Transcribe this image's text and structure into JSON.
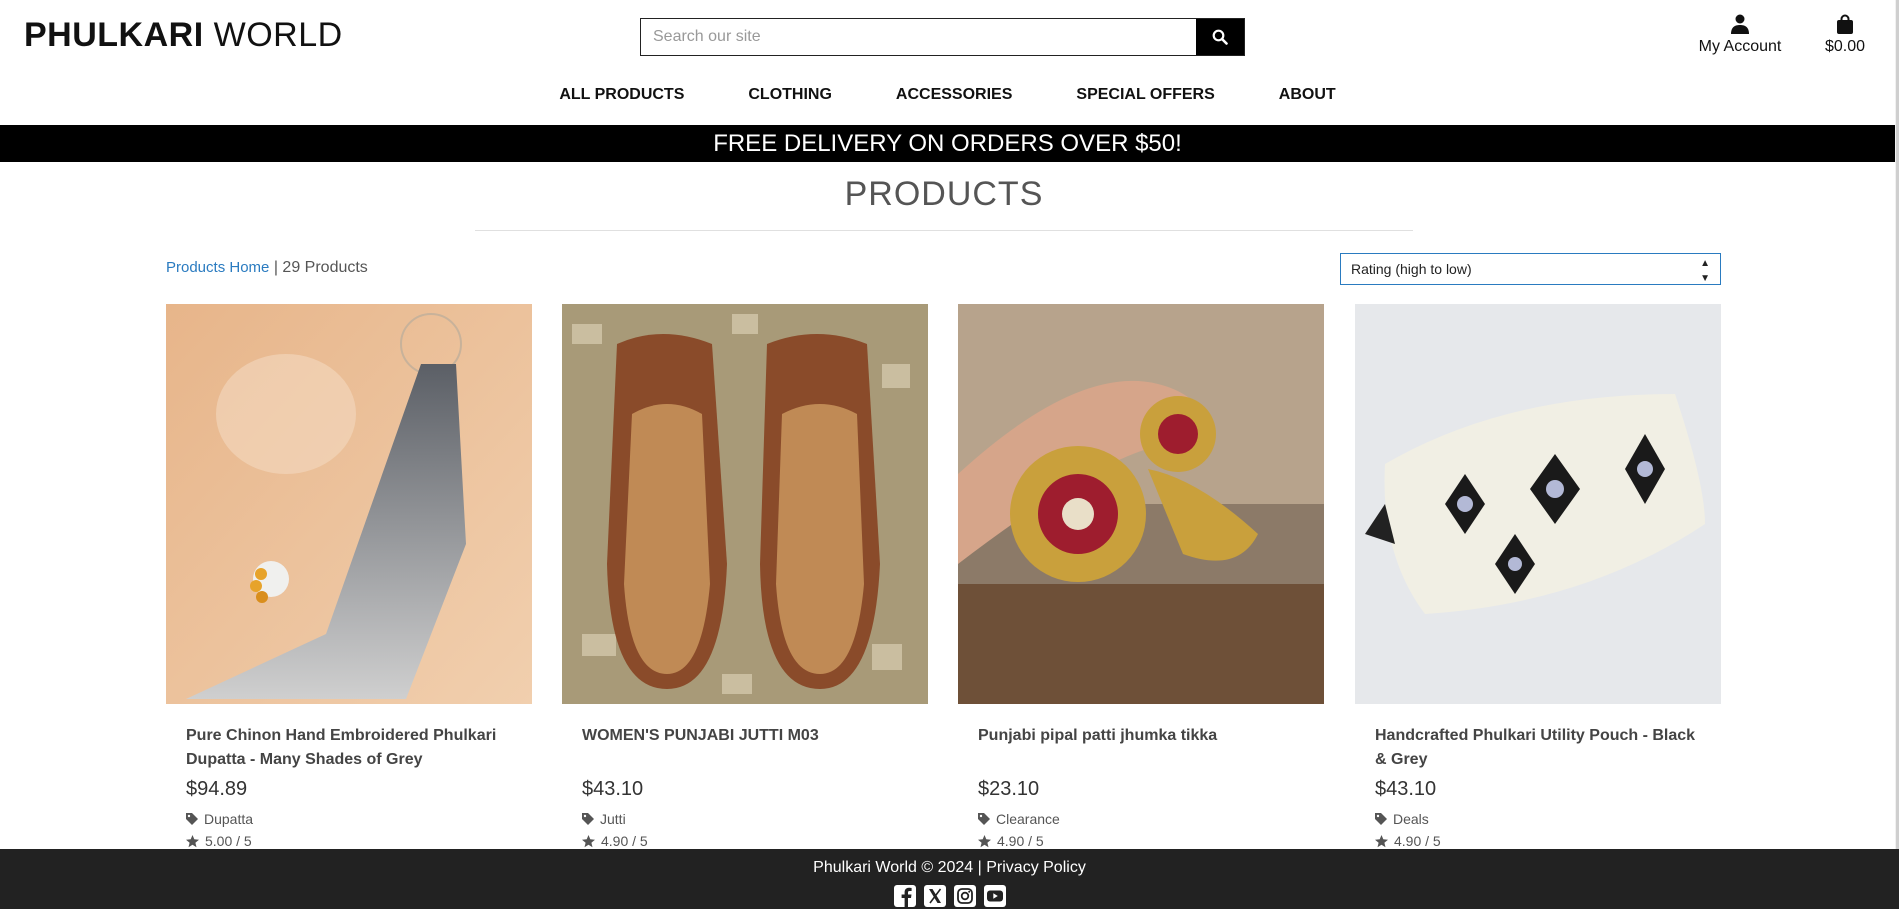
{
  "header": {
    "logo_bold": "PHULKARI",
    "logo_light": "WORLD",
    "search_placeholder": "Search our site",
    "account_label": "My Account",
    "cart_total": "$0.00"
  },
  "nav": {
    "items": [
      "ALL PRODUCTS",
      "CLOTHING",
      "ACCESSORIES",
      "SPECIAL OFFERS",
      "ABOUT"
    ]
  },
  "banner": {
    "text": "FREE DELIVERY ON ORDERS OVER $50!"
  },
  "main": {
    "title": "PRODUCTS",
    "breadcrumb_link": "Products Home",
    "separator": " | ",
    "product_count": "29 Products",
    "sort_selected": "Rating (high to low)"
  },
  "products": [
    {
      "name": "Pure Chinon Hand Embroidered Phulkari Dupatta - Many Shades of Grey",
      "price": "$94.89",
      "category": "Dupatta",
      "rating": "5.00 / 5"
    },
    {
      "name": "WOMEN'S PUNJABI JUTTI M03",
      "price": "$43.10",
      "category": "Jutti",
      "rating": "4.90 / 5"
    },
    {
      "name": "Punjabi pipal patti jhumka tikka",
      "price": "$23.10",
      "category": "Clearance",
      "rating": "4.90 / 5"
    },
    {
      "name": "Handcrafted Phulkari Utility Pouch - Black & Grey",
      "price": "$43.10",
      "category": "Deals",
      "rating": "4.90 / 5"
    }
  ],
  "footer": {
    "copyright": "Phulkari World © 2024 | ",
    "privacy": "Privacy Policy",
    "social_icons": [
      "facebook-icon",
      "x-twitter-icon",
      "instagram-icon",
      "youtube-icon"
    ]
  },
  "colors": {
    "accent_link": "#2a7bc0",
    "banner_bg": "#000000",
    "footer_bg": "#222222"
  }
}
